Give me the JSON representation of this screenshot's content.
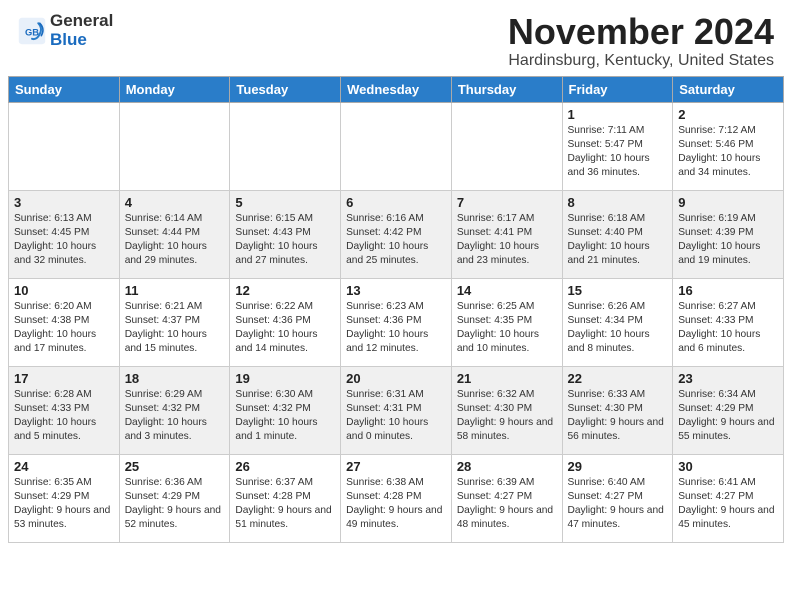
{
  "header": {
    "logo_general": "General",
    "logo_blue": "Blue",
    "main_title": "November 2024",
    "subtitle": "Hardinsburg, Kentucky, United States"
  },
  "days_of_week": [
    "Sunday",
    "Monday",
    "Tuesday",
    "Wednesday",
    "Thursday",
    "Friday",
    "Saturday"
  ],
  "weeks": [
    [
      {
        "day": "",
        "content": ""
      },
      {
        "day": "",
        "content": ""
      },
      {
        "day": "",
        "content": ""
      },
      {
        "day": "",
        "content": ""
      },
      {
        "day": "",
        "content": ""
      },
      {
        "day": "1",
        "content": "Sunrise: 7:11 AM\nSunset: 5:47 PM\nDaylight: 10 hours\nand 36 minutes."
      },
      {
        "day": "2",
        "content": "Sunrise: 7:12 AM\nSunset: 5:46 PM\nDaylight: 10 hours\nand 34 minutes."
      }
    ],
    [
      {
        "day": "3",
        "content": "Sunrise: 6:13 AM\nSunset: 4:45 PM\nDaylight: 10 hours\nand 32 minutes."
      },
      {
        "day": "4",
        "content": "Sunrise: 6:14 AM\nSunset: 4:44 PM\nDaylight: 10 hours\nand 29 minutes."
      },
      {
        "day": "5",
        "content": "Sunrise: 6:15 AM\nSunset: 4:43 PM\nDaylight: 10 hours\nand 27 minutes."
      },
      {
        "day": "6",
        "content": "Sunrise: 6:16 AM\nSunset: 4:42 PM\nDaylight: 10 hours\nand 25 minutes."
      },
      {
        "day": "7",
        "content": "Sunrise: 6:17 AM\nSunset: 4:41 PM\nDaylight: 10 hours\nand 23 minutes."
      },
      {
        "day": "8",
        "content": "Sunrise: 6:18 AM\nSunset: 4:40 PM\nDaylight: 10 hours\nand 21 minutes."
      },
      {
        "day": "9",
        "content": "Sunrise: 6:19 AM\nSunset: 4:39 PM\nDaylight: 10 hours\nand 19 minutes."
      }
    ],
    [
      {
        "day": "10",
        "content": "Sunrise: 6:20 AM\nSunset: 4:38 PM\nDaylight: 10 hours\nand 17 minutes."
      },
      {
        "day": "11",
        "content": "Sunrise: 6:21 AM\nSunset: 4:37 PM\nDaylight: 10 hours\nand 15 minutes."
      },
      {
        "day": "12",
        "content": "Sunrise: 6:22 AM\nSunset: 4:36 PM\nDaylight: 10 hours\nand 14 minutes."
      },
      {
        "day": "13",
        "content": "Sunrise: 6:23 AM\nSunset: 4:36 PM\nDaylight: 10 hours\nand 12 minutes."
      },
      {
        "day": "14",
        "content": "Sunrise: 6:25 AM\nSunset: 4:35 PM\nDaylight: 10 hours\nand 10 minutes."
      },
      {
        "day": "15",
        "content": "Sunrise: 6:26 AM\nSunset: 4:34 PM\nDaylight: 10 hours\nand 8 minutes."
      },
      {
        "day": "16",
        "content": "Sunrise: 6:27 AM\nSunset: 4:33 PM\nDaylight: 10 hours\nand 6 minutes."
      }
    ],
    [
      {
        "day": "17",
        "content": "Sunrise: 6:28 AM\nSunset: 4:33 PM\nDaylight: 10 hours\nand 5 minutes."
      },
      {
        "day": "18",
        "content": "Sunrise: 6:29 AM\nSunset: 4:32 PM\nDaylight: 10 hours\nand 3 minutes."
      },
      {
        "day": "19",
        "content": "Sunrise: 6:30 AM\nSunset: 4:32 PM\nDaylight: 10 hours\nand 1 minute."
      },
      {
        "day": "20",
        "content": "Sunrise: 6:31 AM\nSunset: 4:31 PM\nDaylight: 10 hours\nand 0 minutes."
      },
      {
        "day": "21",
        "content": "Sunrise: 6:32 AM\nSunset: 4:30 PM\nDaylight: 9 hours\nand 58 minutes."
      },
      {
        "day": "22",
        "content": "Sunrise: 6:33 AM\nSunset: 4:30 PM\nDaylight: 9 hours\nand 56 minutes."
      },
      {
        "day": "23",
        "content": "Sunrise: 6:34 AM\nSunset: 4:29 PM\nDaylight: 9 hours\nand 55 minutes."
      }
    ],
    [
      {
        "day": "24",
        "content": "Sunrise: 6:35 AM\nSunset: 4:29 PM\nDaylight: 9 hours\nand 53 minutes."
      },
      {
        "day": "25",
        "content": "Sunrise: 6:36 AM\nSunset: 4:29 PM\nDaylight: 9 hours\nand 52 minutes."
      },
      {
        "day": "26",
        "content": "Sunrise: 6:37 AM\nSunset: 4:28 PM\nDaylight: 9 hours\nand 51 minutes."
      },
      {
        "day": "27",
        "content": "Sunrise: 6:38 AM\nSunset: 4:28 PM\nDaylight: 9 hours\nand 49 minutes."
      },
      {
        "day": "28",
        "content": "Sunrise: 6:39 AM\nSunset: 4:27 PM\nDaylight: 9 hours\nand 48 minutes."
      },
      {
        "day": "29",
        "content": "Sunrise: 6:40 AM\nSunset: 4:27 PM\nDaylight: 9 hours\nand 47 minutes."
      },
      {
        "day": "30",
        "content": "Sunrise: 6:41 AM\nSunset: 4:27 PM\nDaylight: 9 hours\nand 45 minutes."
      }
    ]
  ]
}
